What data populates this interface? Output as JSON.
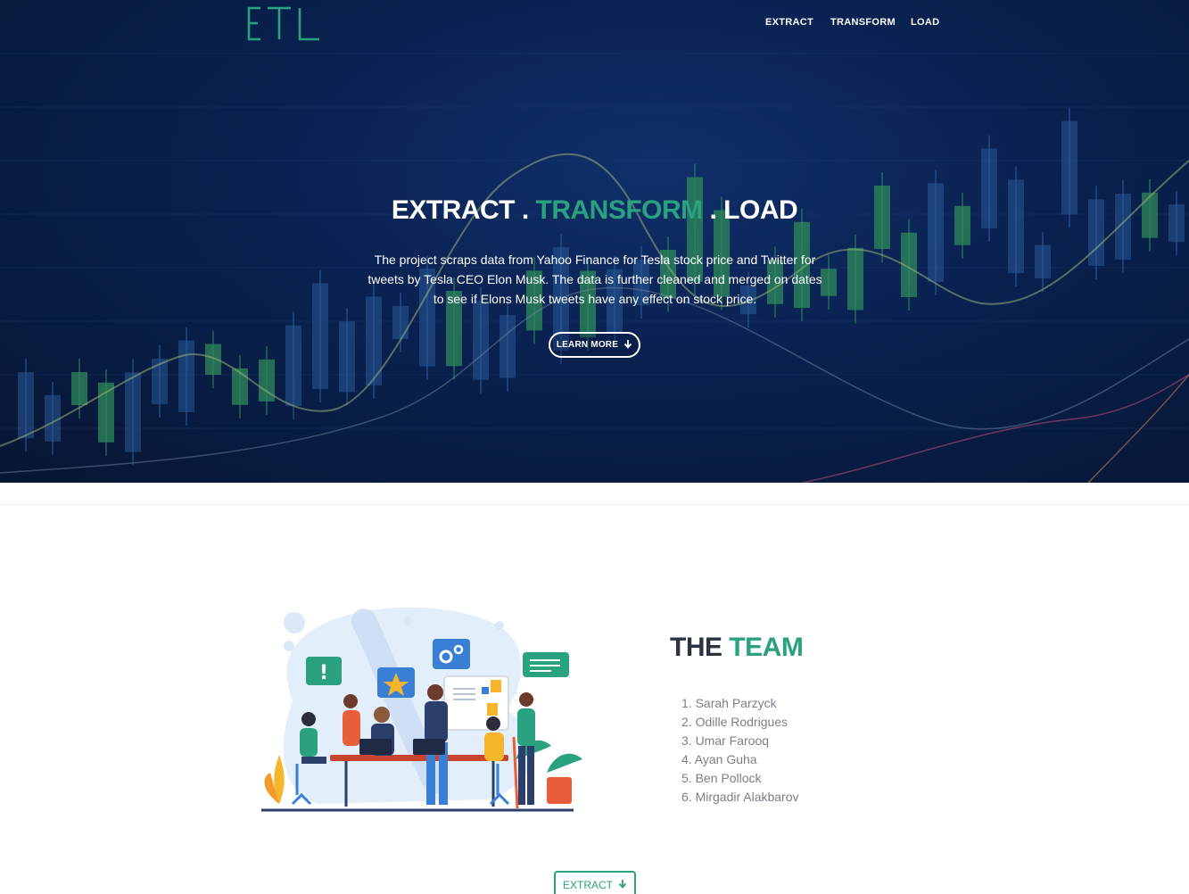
{
  "nav": {
    "logo": "ETL",
    "links": [
      "EXTRACT",
      "TRANSFORM",
      "LOAD"
    ]
  },
  "hero": {
    "title_part1": "EXTRACT .",
    "title_part2": "TRANSFORM",
    "title_part3": ". LOAD",
    "description": "The project scraps data from Yahoo Finance for Tesla stock price and Twitter for tweets by Tesla CEO Elon Musk. The data is further cleaned and merged on dates to see if Elons Musk tweets have any effect on stock price.",
    "button_label": "LEARN MORE",
    "button_icon": "arrow-down-icon"
  },
  "team": {
    "title_part1": "THE",
    "title_part2": "TEAM",
    "members": [
      "1. Sarah Parzyck",
      "2. Odille Rodrigues",
      "3. Umar Farooq",
      "4. Ayan Guha",
      "5. Ben Pollock",
      "6. Mirgadir Alakbarov"
    ]
  },
  "footer_button": {
    "label": "EXTRACT",
    "icon": "arrow-down-icon"
  },
  "colors": {
    "accent": "#2aa17f",
    "hero_bg": "#0a2252",
    "heading": "#2b3440",
    "muted_text": "#7a7f87"
  }
}
